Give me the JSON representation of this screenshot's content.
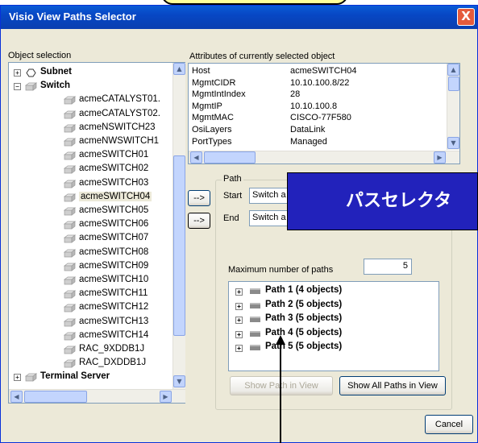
{
  "window": {
    "title": "Visio View Paths Selector",
    "close_label": "X"
  },
  "object_selection": {
    "label": "Object selection",
    "tree": [
      {
        "label": "Subnet",
        "bold": true,
        "level": 0,
        "expander": "+",
        "icon": "subnet-icon"
      },
      {
        "label": "Switch",
        "bold": true,
        "level": 0,
        "expander": "−",
        "icon": "switch-icon"
      },
      {
        "label": "acmeCATALYST01.",
        "level": 1,
        "icon": "device-icon"
      },
      {
        "label": "acmeCATALYST02.",
        "level": 1,
        "icon": "device-icon"
      },
      {
        "label": "acmeNSWITCH23",
        "level": 1,
        "icon": "device-icon"
      },
      {
        "label": "acmeNWSWITCH1",
        "level": 1,
        "icon": "device-icon"
      },
      {
        "label": "acmeSWITCH01",
        "level": 1,
        "icon": "device-icon"
      },
      {
        "label": "acmeSWITCH02",
        "level": 1,
        "icon": "device-icon"
      },
      {
        "label": "acmeSWITCH03",
        "level": 1,
        "icon": "device-icon"
      },
      {
        "label": "acmeSWITCH04",
        "level": 1,
        "icon": "device-icon",
        "selected": true
      },
      {
        "label": "acmeSWITCH05",
        "level": 1,
        "icon": "device-icon"
      },
      {
        "label": "acmeSWITCH06",
        "level": 1,
        "icon": "device-icon"
      },
      {
        "label": "acmeSWITCH07",
        "level": 1,
        "icon": "device-icon"
      },
      {
        "label": "acmeSWITCH08",
        "level": 1,
        "icon": "device-icon"
      },
      {
        "label": "acmeSWITCH09",
        "level": 1,
        "icon": "device-icon"
      },
      {
        "label": "acmeSWITCH10",
        "level": 1,
        "icon": "device-icon"
      },
      {
        "label": "acmeSWITCH11",
        "level": 1,
        "icon": "device-icon"
      },
      {
        "label": "acmeSWITCH12",
        "level": 1,
        "icon": "device-icon"
      },
      {
        "label": "acmeSWITCH13",
        "level": 1,
        "icon": "device-icon"
      },
      {
        "label": "acmeSWITCH14",
        "level": 1,
        "icon": "device-icon"
      },
      {
        "label": "RAC_9XDDB1J",
        "level": 1,
        "icon": "device-icon"
      },
      {
        "label": "RAC_DXDDB1J",
        "level": 1,
        "icon": "device-icon"
      },
      {
        "label": "Terminal Server",
        "bold": true,
        "level": 0,
        "expander": "+",
        "icon": "terminal-server-icon"
      }
    ]
  },
  "attributes": {
    "label": "Attributes of currently selected object",
    "rows": [
      {
        "key": "Host",
        "value": "acmeSWITCH04"
      },
      {
        "key": "MgmtCIDR",
        "value": "10.10.100.8/22"
      },
      {
        "key": "MgmtIntIndex",
        "value": "28"
      },
      {
        "key": "MgmtIP",
        "value": "10.10.100.8"
      },
      {
        "key": "MgmtMAC",
        "value": "CISCO-77F580"
      },
      {
        "key": "OsiLayers",
        "value": "DataLink"
      },
      {
        "key": "PortTypes",
        "value": "Managed"
      }
    ]
  },
  "path": {
    "group_label": "Path",
    "start_label": "Start",
    "start_value": "Switch a",
    "end_label": "End",
    "end_value": "Switch a",
    "arrow_start": "-->",
    "arrow_end": "-->",
    "max_paths_label": "Maximum number of paths",
    "max_paths_value": "5",
    "paths": [
      {
        "expander": "+",
        "label": "Path 1 (4 objects)"
      },
      {
        "expander": "+",
        "label": "Path 2 (5 objects)"
      },
      {
        "expander": "+",
        "label": "Path 3 (5 objects)"
      },
      {
        "expander": "+",
        "label": "Path 4 (5 objects)"
      },
      {
        "expander": "+",
        "label": "Path 5 (5 objects)"
      }
    ],
    "show_path_label": "Show Path in View",
    "show_all_label": "Show All Paths in View"
  },
  "cancel_label": "Cancel",
  "overlay": {
    "text": "パスセレクタ",
    "bg": "#2222bb"
  },
  "colors": {
    "title_bar": "#0747c4",
    "window_bg": "#ece9d8",
    "selected_bg": "#ece9d8"
  }
}
